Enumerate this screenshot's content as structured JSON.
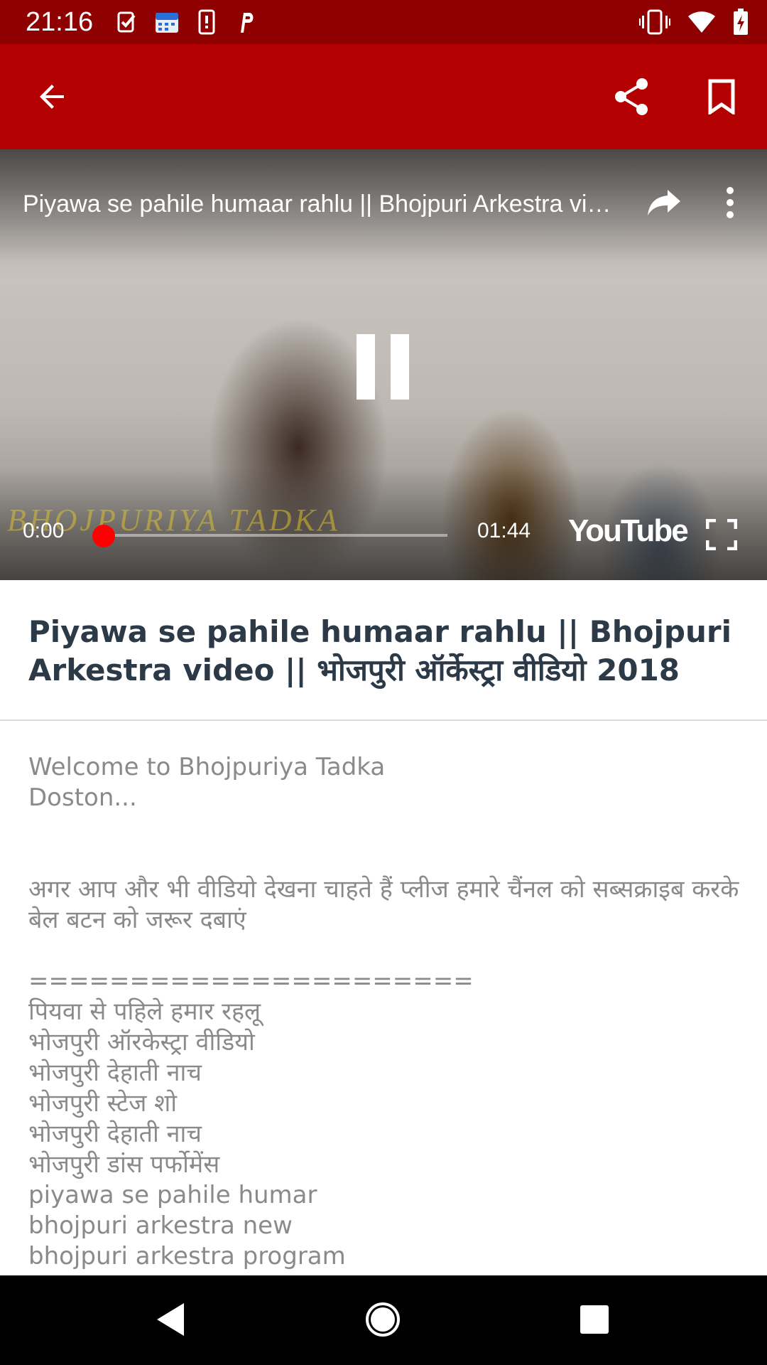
{
  "status_bar": {
    "time": "21:16",
    "left_icons": [
      "task-check-icon",
      "calendar-icon",
      "phone-alert-icon",
      "p-app-icon"
    ],
    "right_icons": [
      "vibrate-icon",
      "wifi-icon",
      "battery-charging-icon"
    ],
    "background": "#8f0000"
  },
  "toolbar": {
    "background": "#b30000",
    "icons": [
      "back-arrow-icon",
      "share-icon",
      "bookmark-icon"
    ]
  },
  "video_player": {
    "title": "Piyawa se pahile humaar rahlu || Bhojpuri Arkestra video || भोजपुरी ऑर्केस्ट्रा वीडियो 2018",
    "watermark": "BHOJPURIYA TADKA",
    "current_time": "0:00",
    "total_time": "01:44",
    "progress": 0,
    "state": "playing",
    "brand": "YouTube",
    "progress_color": "#ff0000"
  },
  "content": {
    "title": "Piyawa se pahile humaar rahlu || Bhojpuri Arkestra video || भोजपुरी ऑर्केस्ट्रा वीडियो 2018",
    "description": [
      "Welcome to Bhojpuriya Tadka\nDoston...",
      "",
      "अगर आप और भी वीडियो देखना चाहते हैं प्लीज हमारे चैंनल को सब्सक्राइब करके बेल बटन को जरूर दबाएं",
      "======================\nपियवा से पहिले हमार रहलू\nभोजपुरी ऑरकेस्ट्रा वीडियो\nभोजपुरी देहाती नाच\nभोजपुरी स्टेज शो\nभोजपुरी देहाती नाच\nभोजपुरी डांस पर्फोमेंस\npiyawa se pahile humar\nbhojpuri arkestra new\nbhojpuri arkestra program"
    ]
  },
  "nav_bar": {
    "icons": [
      "nav-back-icon",
      "nav-home-icon",
      "nav-recent-icon"
    ]
  }
}
